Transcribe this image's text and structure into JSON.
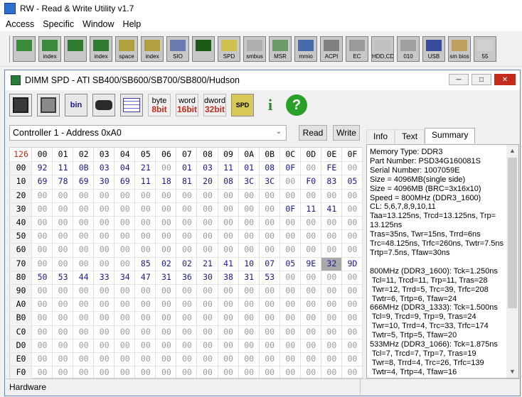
{
  "app": {
    "title": "RW - Read & Write Utility v1.7"
  },
  "menu": [
    "Access",
    "Specific",
    "Window",
    "Help"
  ],
  "toolbar": {
    "items": [
      {
        "name": "pci",
        "label": ""
      },
      {
        "name": "pci-index",
        "label": "index"
      },
      {
        "name": "memory",
        "label": ""
      },
      {
        "name": "memory-index",
        "label": "index"
      },
      {
        "name": "io-space",
        "label": "space"
      },
      {
        "name": "io-index",
        "label": "index"
      },
      {
        "name": "super-io",
        "label": "SIO"
      },
      {
        "name": "waveform",
        "label": ""
      },
      {
        "name": "spd",
        "label": "SPD"
      },
      {
        "name": "smbus",
        "label": "smbus"
      },
      {
        "name": "msr",
        "label": "MSR"
      },
      {
        "name": "mmio",
        "label": "mmio"
      },
      {
        "name": "acpi",
        "label": "ACPI"
      },
      {
        "name": "ec",
        "label": "EC"
      },
      {
        "name": "hdd",
        "label": "HDD,CD"
      },
      {
        "name": "disk",
        "label": "010"
      },
      {
        "name": "usb",
        "label": "USB"
      },
      {
        "name": "smbios",
        "label": "sm bios"
      },
      {
        "name": "more",
        "label": "55"
      }
    ]
  },
  "child": {
    "title": "DIMM SPD - ATI SB400/SB600/SB700/SB800/Hudson",
    "toolbar": {
      "byte_top": "byte",
      "byte_bot": "8bit",
      "word_top": "word",
      "word_bot": "16bit",
      "dword_top": "dword",
      "dword_bot": "32bit",
      "spd": "SPD",
      "bin": "bin",
      "info": "i",
      "help": "?"
    },
    "controller": "Controller 1 - Address 0xA0",
    "read_label": "Read",
    "write_label": "Write",
    "tabs": [
      "Info",
      "Text",
      "Summary"
    ],
    "active_tab": "Summary",
    "status": "Hardware",
    "accent": "#c42b1c"
  },
  "grid": {
    "corner": "126",
    "cols": [
      "00",
      "01",
      "02",
      "03",
      "04",
      "05",
      "06",
      "07",
      "08",
      "09",
      "0A",
      "0B",
      "0C",
      "0D",
      "0E",
      "0F"
    ],
    "rows": [
      {
        "label": "00",
        "cells": [
          "92",
          "11",
          "0B",
          "03",
          "04",
          "21",
          "00",
          "01",
          "03",
          "11",
          "01",
          "08",
          "0F",
          "00",
          "FE",
          "00"
        ]
      },
      {
        "label": "10",
        "cells": [
          "69",
          "78",
          "69",
          "30",
          "69",
          "11",
          "18",
          "81",
          "20",
          "08",
          "3C",
          "3C",
          "00",
          "F0",
          "83",
          "05"
        ]
      },
      {
        "label": "20",
        "cells": [
          "00",
          "00",
          "00",
          "00",
          "00",
          "00",
          "00",
          "00",
          "00",
          "00",
          "00",
          "00",
          "00",
          "00",
          "00",
          "00"
        ]
      },
      {
        "label": "30",
        "cells": [
          "00",
          "00",
          "00",
          "00",
          "00",
          "00",
          "00",
          "00",
          "00",
          "00",
          "00",
          "00",
          "0F",
          "11",
          "41",
          "00"
        ]
      },
      {
        "label": "40",
        "cells": [
          "00",
          "00",
          "00",
          "00",
          "00",
          "00",
          "00",
          "00",
          "00",
          "00",
          "00",
          "00",
          "00",
          "00",
          "00",
          "00"
        ]
      },
      {
        "label": "50",
        "cells": [
          "00",
          "00",
          "00",
          "00",
          "00",
          "00",
          "00",
          "00",
          "00",
          "00",
          "00",
          "00",
          "00",
          "00",
          "00",
          "00"
        ]
      },
      {
        "label": "60",
        "cells": [
          "00",
          "00",
          "00",
          "00",
          "00",
          "00",
          "00",
          "00",
          "00",
          "00",
          "00",
          "00",
          "00",
          "00",
          "00",
          "00"
        ]
      },
      {
        "label": "70",
        "cells": [
          "00",
          "00",
          "00",
          "00",
          "00",
          "85",
          "02",
          "02",
          "21",
          "41",
          "10",
          "07",
          "05",
          "9E",
          "32",
          "9D"
        ]
      },
      {
        "label": "80",
        "cells": [
          "50",
          "53",
          "44",
          "33",
          "34",
          "47",
          "31",
          "36",
          "30",
          "38",
          "31",
          "53",
          "00",
          "00",
          "00",
          "00"
        ]
      },
      {
        "label": "90",
        "cells": [
          "00",
          "00",
          "00",
          "00",
          "00",
          "00",
          "00",
          "00",
          "00",
          "00",
          "00",
          "00",
          "00",
          "00",
          "00",
          "00"
        ]
      },
      {
        "label": "A0",
        "cells": [
          "00",
          "00",
          "00",
          "00",
          "00",
          "00",
          "00",
          "00",
          "00",
          "00",
          "00",
          "00",
          "00",
          "00",
          "00",
          "00"
        ]
      },
      {
        "label": "B0",
        "cells": [
          "00",
          "00",
          "00",
          "00",
          "00",
          "00",
          "00",
          "00",
          "00",
          "00",
          "00",
          "00",
          "00",
          "00",
          "00",
          "00"
        ]
      },
      {
        "label": "C0",
        "cells": [
          "00",
          "00",
          "00",
          "00",
          "00",
          "00",
          "00",
          "00",
          "00",
          "00",
          "00",
          "00",
          "00",
          "00",
          "00",
          "00"
        ]
      },
      {
        "label": "D0",
        "cells": [
          "00",
          "00",
          "00",
          "00",
          "00",
          "00",
          "00",
          "00",
          "00",
          "00",
          "00",
          "00",
          "00",
          "00",
          "00",
          "00"
        ]
      },
      {
        "label": "E0",
        "cells": [
          "00",
          "00",
          "00",
          "00",
          "00",
          "00",
          "00",
          "00",
          "00",
          "00",
          "00",
          "00",
          "00",
          "00",
          "00",
          "00"
        ]
      },
      {
        "label": "F0",
        "cells": [
          "00",
          "00",
          "00",
          "00",
          "00",
          "00",
          "00",
          "00",
          "00",
          "00",
          "00",
          "00",
          "00",
          "00",
          "00",
          "00"
        ]
      }
    ],
    "selected": "7E"
  },
  "summary": [
    "Memory Type: DDR3",
    "Part Number: PSD34G160081S",
    "Serial Number: 1007059E",
    "Size = 4096MB(single side)",
    "Size = 4096MB (BRC=3x16x10)",
    "Speed = 800MHz (DDR3_1600)",
    "CL: 5,6,7,8,9,10,11",
    "Taa=13.125ns, Trcd=13.125ns, Trp=",
    "13.125ns",
    "Tras=35ns, Twr=15ns, Trrd=6ns",
    "Trc=48.125ns, Trfc=260ns, Twtr=7.5ns",
    "Trtp=7.5ns, Tfaw=30ns",
    "",
    "800MHz (DDR3_1600): Tck=1.250ns",
    " Tcl=11, Trcd=11, Trp=11, Tras=28",
    " Twr=12, Trrd=5, Trc=39, Trfc=208",
    " Twtr=6, Trtp=6, Tfaw=24",
    "666MHz (DDR3_1333): Tck=1.500ns",
    " Tcl=9, Trcd=9, Trp=9, Tras=24",
    " Twr=10, Trrd=4, Trc=33, Trfc=174",
    " Twtr=5, Trtp=5, Tfaw=20",
    "533MHz (DDR3_1066): Tck=1.875ns",
    " Tcl=7, Trcd=7, Trp=7, Tras=19",
    " Twr=8, Trrd=4, Trc=26, Trfc=139",
    " Twtr=4, Trtp=4, Tfaw=16"
  ]
}
